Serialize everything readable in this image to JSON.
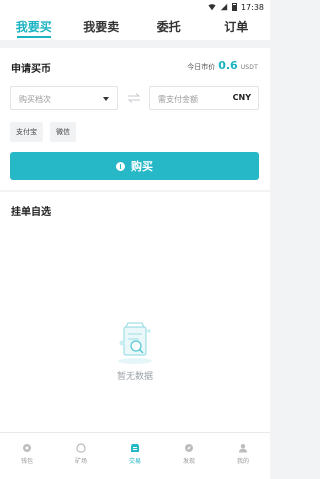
{
  "status_bar": {
    "time": "17:38"
  },
  "tabs": [
    {
      "label": "我要买",
      "active": true
    },
    {
      "label": "我要卖",
      "active": false
    },
    {
      "label": "委托",
      "active": false
    },
    {
      "label": "订单",
      "active": false
    }
  ],
  "apply": {
    "title": "申请买币",
    "price_label": "今日市价",
    "price_value": "0.6",
    "price_unit": "USDT",
    "tier_placeholder": "购买档次",
    "amount_placeholder": "需支付金额",
    "currency": "CNY",
    "payment_methods": [
      "支付宝",
      "微信"
    ],
    "buy_button": "购买"
  },
  "listings": {
    "title": "挂单自选",
    "empty_text": "暂无数据"
  },
  "bottom_nav": [
    {
      "label": "钱包",
      "icon": "wallet-icon",
      "active": false
    },
    {
      "label": "矿场",
      "icon": "mine-icon",
      "active": false
    },
    {
      "label": "交易",
      "icon": "trade-icon",
      "active": true
    },
    {
      "label": "发现",
      "icon": "discover-icon",
      "active": false
    },
    {
      "label": "我的",
      "icon": "profile-icon",
      "active": false
    }
  ],
  "colors": {
    "accent": "#27b8c8",
    "tab_active": "#1ab3c1",
    "background": "#f2f3f5"
  }
}
